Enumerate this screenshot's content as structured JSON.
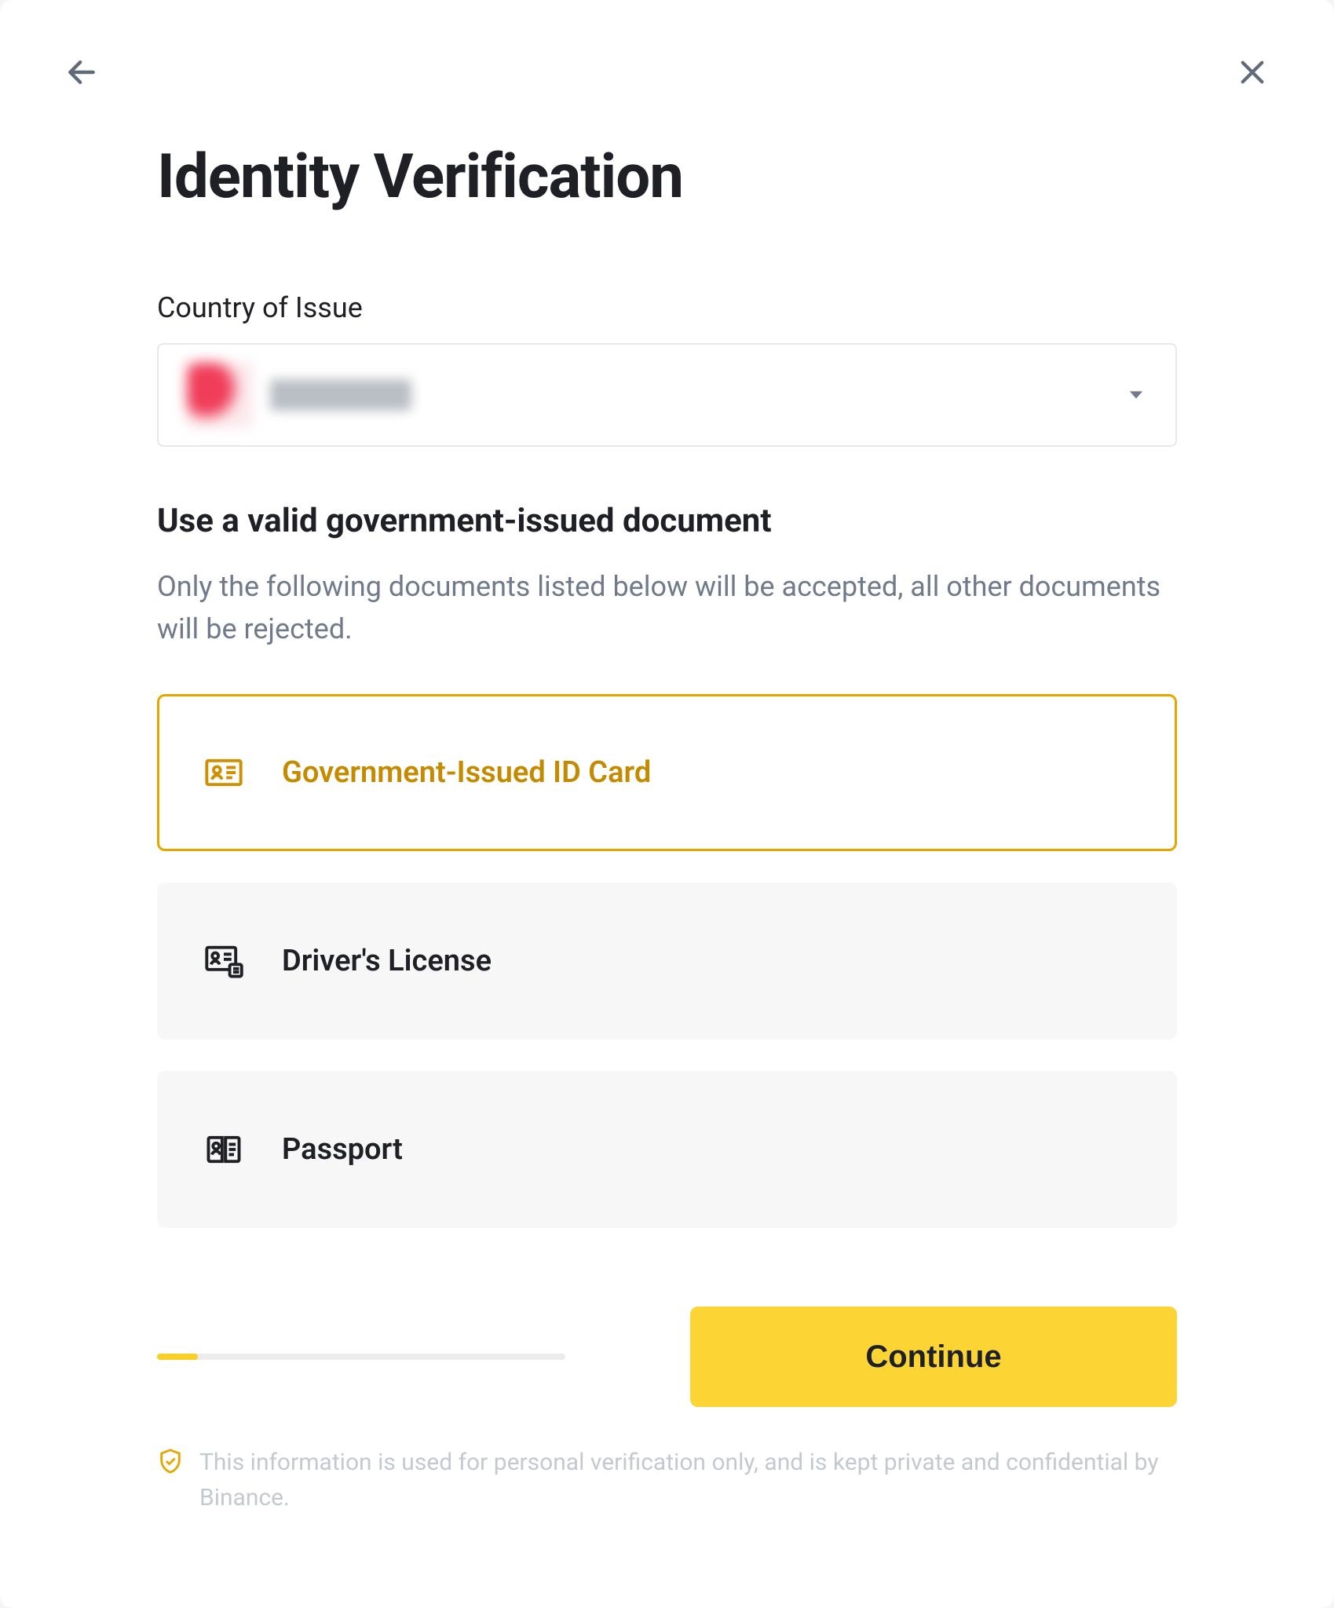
{
  "header": {
    "title": "Identity Verification"
  },
  "country": {
    "label": "Country of Issue",
    "value_redacted": true
  },
  "document_section": {
    "title": "Use a valid government-issued document",
    "description": "Only the following documents listed below will be accepted, all other documents will be rejected."
  },
  "options": [
    {
      "id": "id-card",
      "label": "Government-Issued ID Card",
      "selected": true
    },
    {
      "id": "drivers-license",
      "label": "Driver's License",
      "selected": false
    },
    {
      "id": "passport",
      "label": "Passport",
      "selected": false
    }
  ],
  "footer": {
    "progress_percent": 10,
    "continue_label": "Continue",
    "disclaimer": "This information is used for personal verification only, and is kept private and confidential by Binance."
  },
  "colors": {
    "accent": "#fcd535",
    "accent_border": "#e8a500",
    "text_primary": "#1e2026",
    "text_secondary": "#707a8a"
  }
}
